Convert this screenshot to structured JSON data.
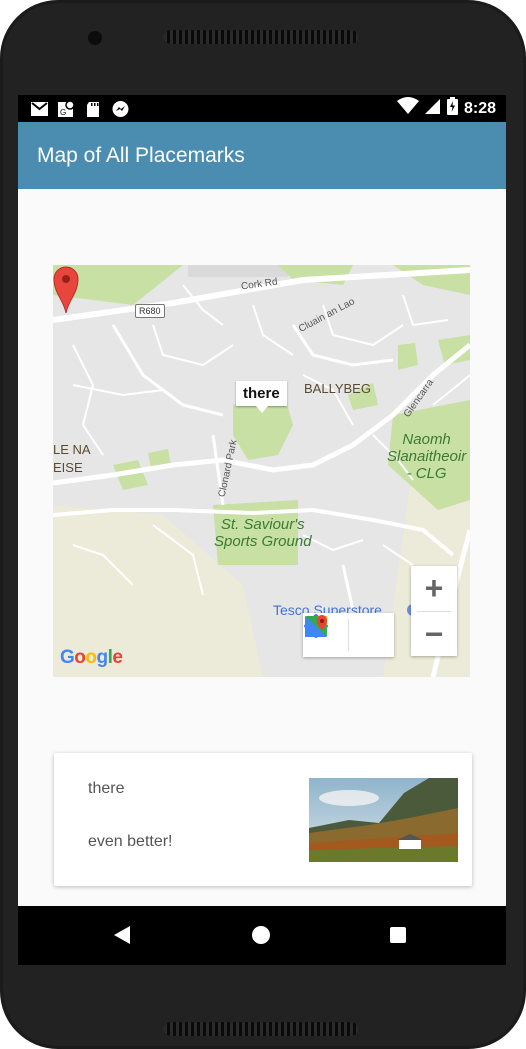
{
  "status_bar": {
    "time": "8:28",
    "icons": [
      "gmail-icon",
      "maps-notification-icon",
      "sd-card-icon",
      "messenger-icon",
      "wifi-icon",
      "signal-icon",
      "battery-charging-icon"
    ]
  },
  "app_bar": {
    "title": "Map of All Placemarks"
  },
  "map": {
    "marker": {
      "label": "there",
      "color": "#e8453c"
    },
    "labels": {
      "ballybeg": "BALLYBEG",
      "le_na": "LE NA",
      "eise": "EISE",
      "naomh": "Naomh\nSlanaitheoir\n- CLG",
      "st_saviours": "St. Saviour's\nSports Ground",
      "tesco": "Tesco Superstore",
      "cork_rd": "Cork Rd",
      "cluain": "Cluain an Lao",
      "clonard": "Clonard Park",
      "glencarra": "Glencarra",
      "r680": "R680"
    },
    "controls": {
      "zoom_in": "+",
      "zoom_out": "−",
      "directions_icon": "directions-icon",
      "open_maps_icon": "google-maps-icon"
    },
    "attribution": "Google",
    "colors": {
      "land": "#e6e6e6",
      "park": "#c8e0a4",
      "road": "#ffffff",
      "sand": "#ecead9"
    }
  },
  "card": {
    "title": "there",
    "description": "even better!",
    "image_icon": "landscape-photo"
  },
  "nav_bar": {
    "icons": [
      "back-icon",
      "home-icon",
      "recents-icon"
    ]
  }
}
